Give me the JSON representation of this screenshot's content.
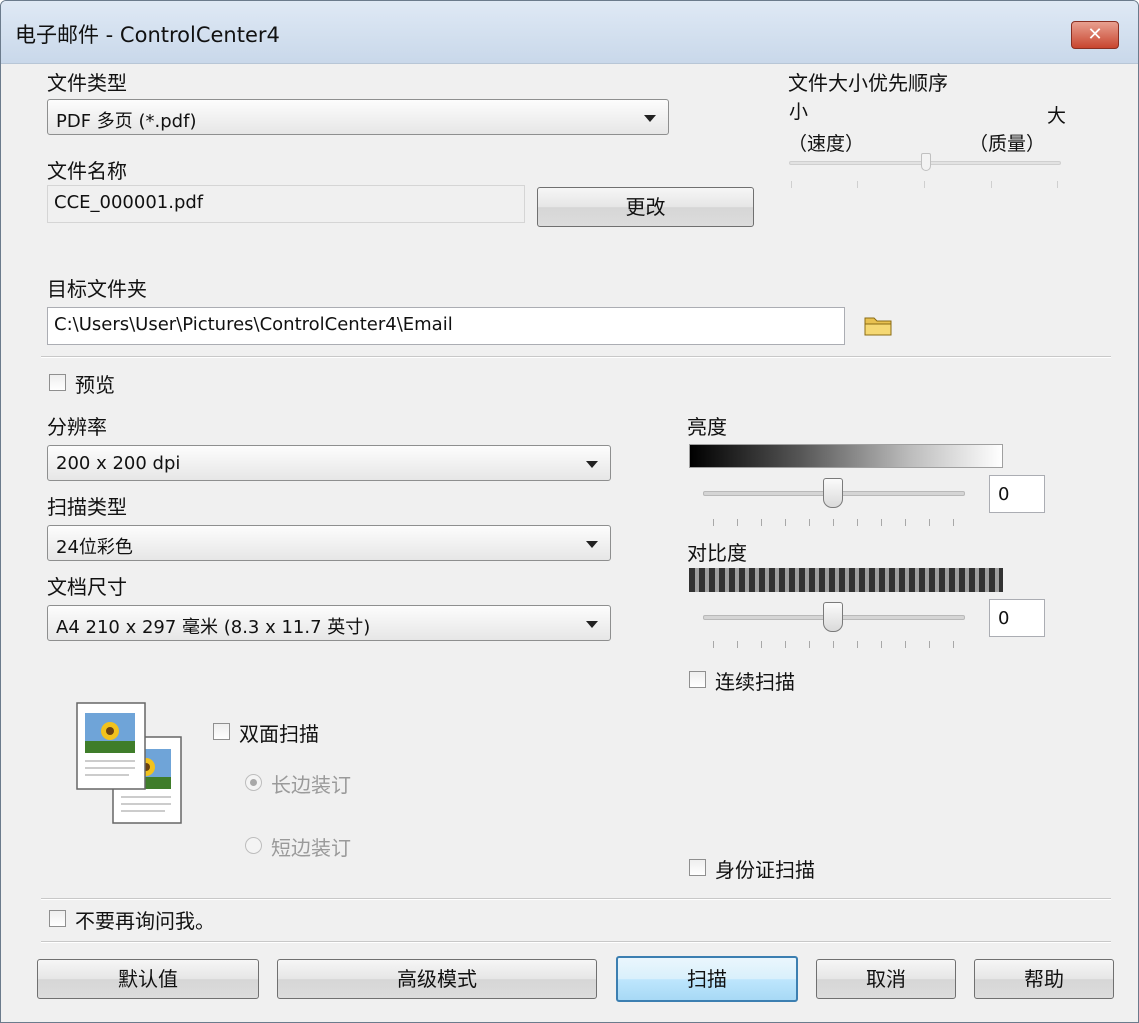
{
  "window": {
    "title": "电子邮件 - ControlCenter4",
    "close_glyph": "✕"
  },
  "file_type": {
    "label": "文件类型",
    "value": "PDF 多页 (*.pdf)"
  },
  "file_name": {
    "label": "文件名称",
    "value": "CCE_000001.pdf",
    "change_button": "更改"
  },
  "size_priority": {
    "label": "文件大小优先顺序",
    "left_label": "小",
    "right_label": "大",
    "left_sub": "（速度）",
    "right_sub": "（质量）",
    "level": 0.5
  },
  "target_folder": {
    "label": "目标文件夹",
    "value": "C:\\Users\\User\\Pictures\\ControlCenter4\\Email",
    "icon": "folder-icon"
  },
  "preview": {
    "label": "预览",
    "checked": false
  },
  "resolution": {
    "label": "分辨率",
    "value": "200 x 200 dpi"
  },
  "scan_type": {
    "label": "扫描类型",
    "value": "24位彩色"
  },
  "document_size": {
    "label": "文档尺寸",
    "value": "A4 210 x 297 毫米 (8.3 x 11.7 英寸)"
  },
  "brightness": {
    "label": "亮度",
    "value": "0"
  },
  "contrast": {
    "label": "对比度",
    "value": "0"
  },
  "continuous_scan": {
    "label": "连续扫描",
    "checked": false
  },
  "duplex": {
    "label": "双面扫描",
    "checked": false,
    "long_edge": "长边装订",
    "short_edge": "短边装订",
    "selected": "long_edge",
    "icon": "duplex-pages-icon"
  },
  "id_card_scan": {
    "label": "身份证扫描",
    "checked": false
  },
  "dont_ask": {
    "label": "不要再询问我。",
    "checked": false
  },
  "buttons": {
    "default": "默认值",
    "advanced": "高级模式",
    "scan": "扫描",
    "cancel": "取消",
    "help": "帮助"
  },
  "colors": {
    "titlebar": "#c9d8ea",
    "close": "#c8452f",
    "default_button_border": "#3c7fb1"
  }
}
